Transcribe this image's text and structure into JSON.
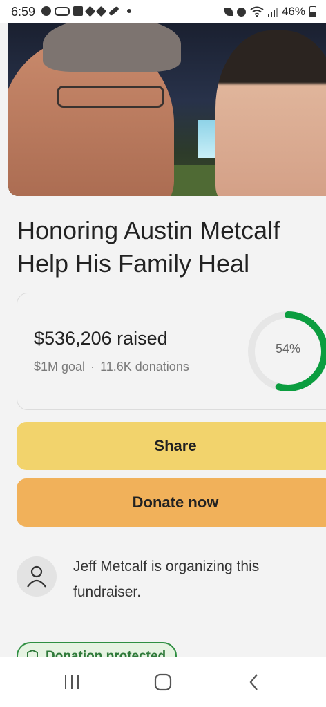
{
  "status_bar": {
    "time": "6:59",
    "battery": "46%",
    "notification_icons": [
      "messenger-icon",
      "voicemail-icon",
      "square-app-icon",
      "dropbox-icon",
      "dropbox-icon",
      "link-icon",
      "dot-icon"
    ],
    "system_icons": [
      "leaf-icon",
      "alarm-icon",
      "wifi-icon",
      "signal-icon",
      "battery-icon"
    ]
  },
  "fundraiser": {
    "title": "Honoring Austin Metcalf Help His Family Heal",
    "raised": "$536,206 raised",
    "goal": "$1M goal",
    "separator": "·",
    "donations": "11.6K donations",
    "progress_percent": 54,
    "progress_label": "54%"
  },
  "actions": {
    "share_label": "Share",
    "donate_label": "Donate now"
  },
  "organizer": {
    "text": "Jeff Metcalf is organizing this fundraiser."
  },
  "badge": {
    "label": "Donation protected"
  },
  "nav": {
    "buttons": [
      "recent-apps-icon",
      "home-icon",
      "back-icon"
    ]
  },
  "colors": {
    "share_button": "#f2d36c",
    "donate_button": "#f1b15a",
    "progress_ring": "#0b9d3f",
    "badge_border": "#2f8f42"
  }
}
